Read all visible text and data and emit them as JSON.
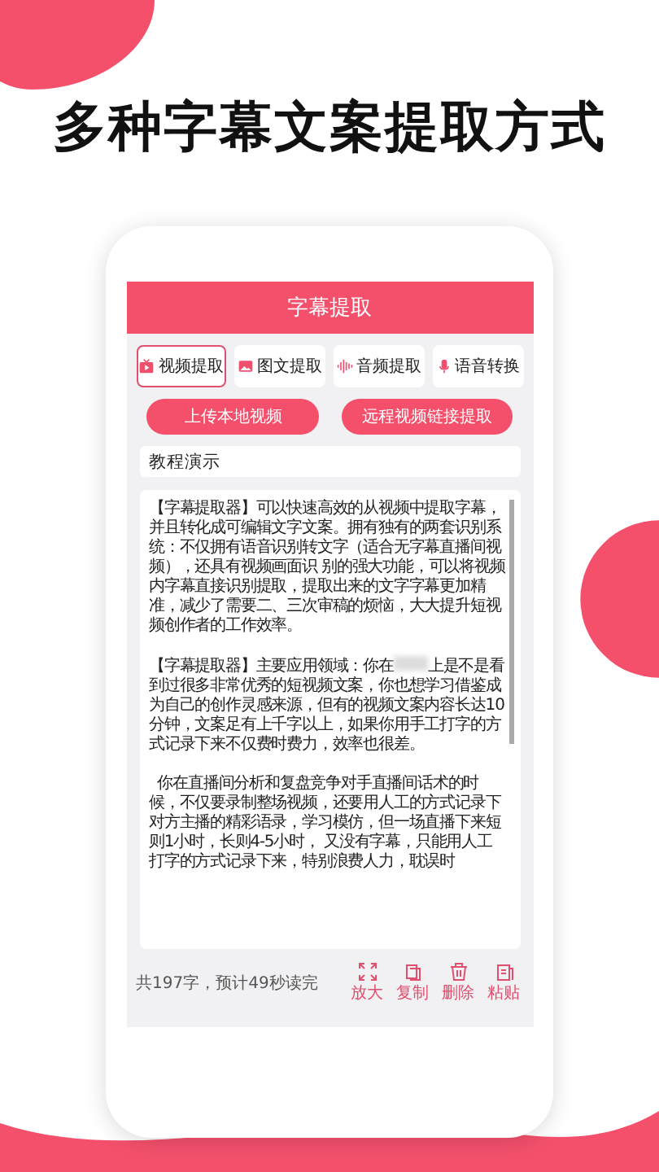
{
  "headline": "多种字幕文案提取方式",
  "app": {
    "title": "字幕提取",
    "tabs": [
      {
        "label": "视频提取",
        "selected": true
      },
      {
        "label": "图文提取",
        "selected": false
      },
      {
        "label": "音频提取",
        "selected": false
      },
      {
        "label": "语音转换",
        "selected": false
      }
    ],
    "buttons": [
      "上传本地视频",
      "远程视频链接提取"
    ],
    "name_field": {
      "value": "教程演示"
    },
    "paragraphs": [
      {
        "before": "【字幕提取器】可以快速高效的从视频中提取字幕，并且转化成可编辑文字文案。拥有独有的两套识别系统：不仅拥有语音识别转文字（适合无字幕直播间视频），还具有视频画面识 别的强大功能，可以将视频内字幕直接识别提取，提取出来的文字字幕更加精准，减少了需要二、三次审稿的烦恼，大大提升短视频创作者的工作效率。"
      },
      {
        "before": "【字幕提取器】主要应用领域：你在",
        "blurred": true,
        "after": "上是不是看到过很多非常优秀的短视频文案，你也想学习借鉴成为自己的创作灵感来源，但有的视频文案内容长达10分钟，文案足有上千字以上，如果你用手工打字的方式记录下来不仅费时费力，效率也很差。"
      },
      {
        "before": "  你在直播间分析和复盘竞争对手直播间话术的时候，不仅要录制整场视频，还要用人工的方式记录下对方主播的精彩语录，学习模仿，但一场直播下来短则1小时，长则4-5小时， 又没有字幕，只能用人工打字的方式记录下来，特别浪费人力，耽误时"
      }
    ],
    "stats": "共197字，预计49秒读完",
    "actions": [
      {
        "label": "放大"
      },
      {
        "label": "复制"
      },
      {
        "label": "删除"
      },
      {
        "label": "粘贴"
      }
    ]
  }
}
